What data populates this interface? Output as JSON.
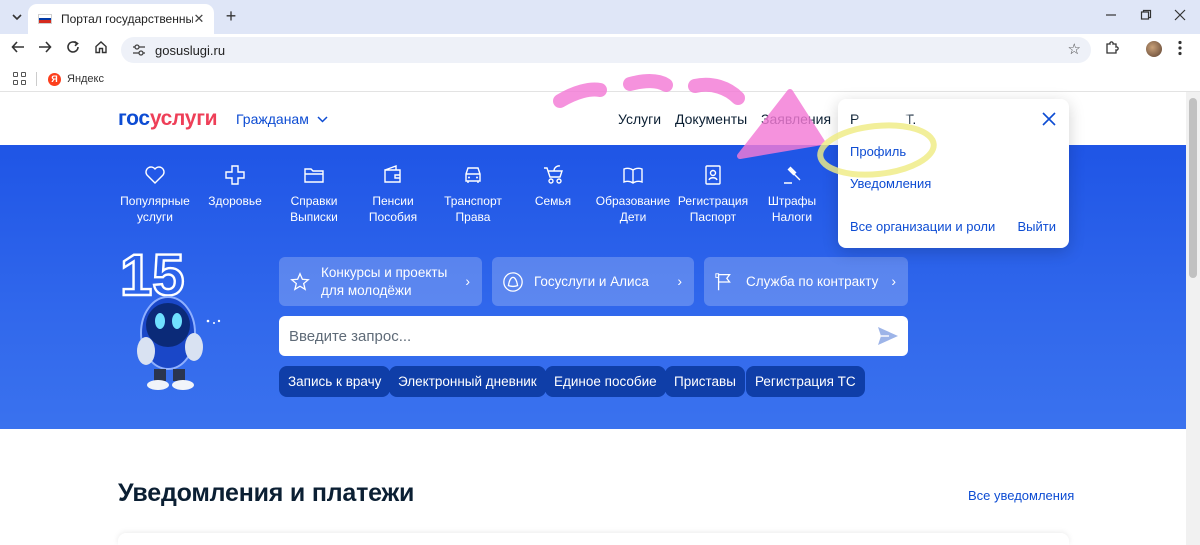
{
  "browser": {
    "tab_title": "Портал государственных услуг",
    "tab_close": "✕",
    "new_tab": "+",
    "url": "gosuslugi.ru",
    "bookmark": "Яндекс",
    "bookmark_icon_letter": "Я",
    "flag_colors": [
      "#ffffff",
      "#0039a6",
      "#d52b1e"
    ]
  },
  "header": {
    "logo_part1": "гос",
    "logo_part2": "услуги",
    "audience": "Гражданам",
    "links": [
      "Услуги",
      "Документы",
      "Заявления"
    ]
  },
  "categories": [
    {
      "label": "Популярные\nуслуги",
      "icon": "heart-icon"
    },
    {
      "label": "Здоровье",
      "icon": "medical-cross-icon"
    },
    {
      "label": "Справки\nВыписки",
      "icon": "folder-icon"
    },
    {
      "label": "Пенсии\nПособия",
      "icon": "wallet-icon"
    },
    {
      "label": "Транспорт\nПрава",
      "icon": "car-icon"
    },
    {
      "label": "Семья",
      "icon": "stroller-icon"
    },
    {
      "label": "Образование\nДети",
      "icon": "book-icon"
    },
    {
      "label": "Регистрация\nПаспорт",
      "icon": "id-card-icon"
    },
    {
      "label": "Штрафы\nНалоги",
      "icon": "gavel-icon"
    }
  ],
  "mascot_badge": "15",
  "promos": [
    {
      "label": "Конкурсы и проекты\nдля молодёжи",
      "icon": "star-icon"
    },
    {
      "label": "Госуслуги и Алиса",
      "icon": "alice-icon"
    },
    {
      "label": "Служба по контракту",
      "icon": "flag-icon"
    }
  ],
  "search": {
    "placeholder": "Введите запрос..."
  },
  "chips": [
    "Запись к врачу",
    "Электронный дневник",
    "Единое пособие",
    "Приставы",
    "Регистрация ТС"
  ],
  "notifications": {
    "title": "Уведомления и платежи",
    "all_link": "Все уведомления"
  },
  "dropdown": {
    "user_initial": "Р",
    "user_tail": "Т.",
    "profile": "Профиль",
    "notifications": "Уведомления",
    "organizations": "Все организации и роли",
    "logout": "Выйти"
  },
  "colors": {
    "brand_blue": "#0d4cd3",
    "brand_red": "#ee3f58",
    "hero_blue": "#2a60ea",
    "chip_blue": "#0f3ea8",
    "annotation_pink": "#f47bd6",
    "annotation_yellow": "#f0ec85"
  }
}
